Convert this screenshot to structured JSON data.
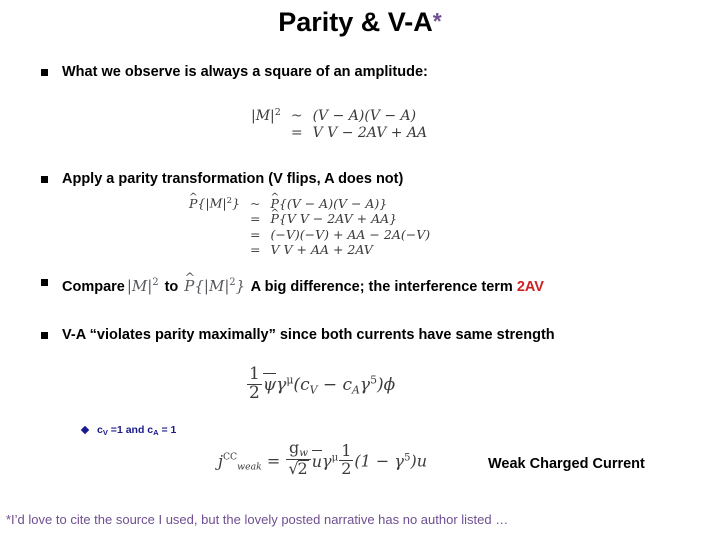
{
  "slide": {
    "title_text": "Parity & V-A",
    "title_star": "*",
    "accent_purple": "#6f4f91",
    "accent_red": "#cc2222",
    "accent_blue": "#1a1a8c"
  },
  "bullets": [
    {
      "marker": "square-bullet",
      "text": "What we observe is always a square of an amplitude:"
    },
    {
      "marker": "square-bullet",
      "text": "Apply a parity transformation (V flips, A does not)"
    },
    {
      "marker": "square-bullet",
      "text_before": "Compare",
      "text_middle": "to",
      "text_after": "A big difference; the interference term",
      "text_highlight": "2AV"
    },
    {
      "marker": "square-bullet",
      "text": "V-A  “violates parity maximally” since both currents  have same strength"
    }
  ],
  "sub_bullet": {
    "marker": "diamond-bullet",
    "c_v_label": "c",
    "c_v_sub": "V",
    "c_v_value": " =1 and ",
    "c_a_label": "c",
    "c_a_sub": "A",
    "c_a_value": " = 1"
  },
  "equations": {
    "amplitude_squared": {
      "lhs": "|M|",
      "lhs_sup": "2",
      "rows": [
        {
          "rel": "~",
          "rhs": "(V − A)(V − A)"
        },
        {
          "rel": "=",
          "rhs": "V V − 2AV + AA"
        }
      ]
    },
    "parity_applied": {
      "lhs_op": "P",
      "lhs_rest": "{|M|",
      "lhs_sup": "2",
      "lhs_close": "}",
      "rows": [
        {
          "rel": "~",
          "op": "P",
          "rhs": "{(V − A)(V − A)}"
        },
        {
          "rel": "=",
          "op": "P",
          "rhs": "{V V − 2AV + AA}"
        },
        {
          "rel": "=",
          "op": "",
          "rhs": "(−V)(−V) + AA − 2A(−V)"
        },
        {
          "rel": "=",
          "op": "",
          "rhs": "V V + AA + 2AV"
        }
      ]
    },
    "inline_m2": {
      "base": "|M|",
      "sup": "2"
    },
    "inline_pm2": {
      "op": "P",
      "base": "{|M|",
      "sup": "2",
      "close": "}"
    },
    "vector_axial_current": {
      "frac_num": "1",
      "frac_den": "2",
      "psi": "ψ",
      "gamma": "γ",
      "gamma_sup": "μ",
      "open": "(",
      "cv": "c",
      "cv_sub": "V",
      "minus": " − ",
      "ca": "c",
      "ca_sub": "A",
      "gamma5": "γ",
      "gamma5_sup": "5",
      "close": ")",
      "phi": "ϕ"
    },
    "weak_charged_current": {
      "j": "j",
      "j_sup": "CC",
      "j_sub": "weak",
      "equals": "=",
      "g_num": "g",
      "g_num_sub": "w",
      "g_den_root": "√",
      "g_den_val": "2",
      "ubar": "u",
      "gamma": "γ",
      "gamma_sup": "μ",
      "half_num": "1",
      "half_den": "2",
      "open": "(1 − ",
      "gamma5": "γ",
      "gamma5_sup": "5",
      "close": ")",
      "u": "u"
    }
  },
  "labels": {
    "weak_charged_current": "Weak Charged Current"
  },
  "footnote": {
    "text": "*I’d love to cite the source I used, but the lovely posted narrative has no author listed …"
  }
}
